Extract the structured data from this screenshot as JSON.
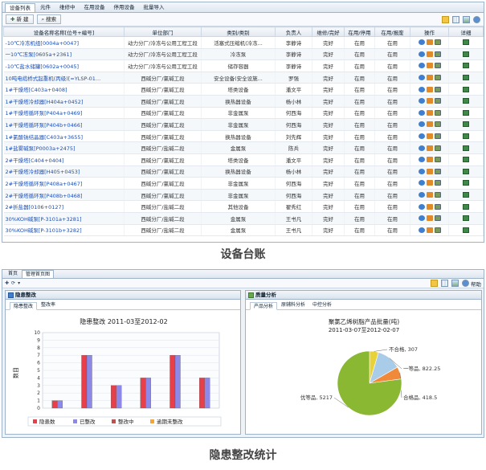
{
  "ledger": {
    "tabs": [
      "设备列表",
      "元件",
      "维修中",
      "在用设备",
      "停用设备",
      "批量导入"
    ],
    "active_tab": 0,
    "toolbar": {
      "new_label": "新 建",
      "search_label": "搜索"
    },
    "columns": [
      "设备名称名称[位号+编号]",
      "单位部门",
      "类别/类别",
      "负责人",
      "维修/完好",
      "在用/停用",
      "在用/报废",
      "操作",
      "详细"
    ],
    "rows": [
      [
        "-10℃冷冻机组[0004a+0047]",
        "动力分厂/冷冻与公用工程工段",
        "活塞式压缩机(冷冻...",
        "李静诗",
        "完好",
        "在用",
        "在用"
      ],
      [
        "一10℃冻泵[0605a+2361]",
        "动力分厂/冷冻与公用工程工段",
        "冷冻泵",
        "李静诗",
        "完好",
        "在用",
        "在用"
      ],
      [
        "-10℃盐水储罐[0602a+0045]",
        "动力分厂/冷冻与公用工程工段",
        "储存容器",
        "李静诗",
        "完好",
        "在用",
        "在用"
      ],
      [
        "10吨电缆桥式起重机(丙级)[=YLSP-01...",
        "西碱分厂/氯碱工段",
        "安全设备(安全设施...",
        "罗强",
        "完好",
        "在用",
        "在用"
      ],
      [
        "1#干燥塔[C403a+0408]",
        "西碱分厂/氯碱工段",
        "塔类设备",
        "潘文平",
        "完好",
        "在用",
        "在用"
      ],
      [
        "1#干燥塔冷却器[H404a+0452]",
        "西碱分厂/氯碱工段",
        "换热器设备",
        "杨小林",
        "完好",
        "在用",
        "在用"
      ],
      [
        "1#干燥塔循环泵[P404a+0469]",
        "西碱分厂/氯碱工段",
        "非金属泵",
        "何西海",
        "完好",
        "在用",
        "在用"
      ],
      [
        "1#干燥塔循环泵[P404b+0466]",
        "西碱分厂/氯碱工段",
        "非金属泵",
        "何西海",
        "完好",
        "在用",
        "在用"
      ],
      [
        "1#氯酸钠结晶器[C403a+3655]",
        "西碱分厂/氯碱工段",
        "换热器设备",
        "刘先辉",
        "完好",
        "在用",
        "在用"
      ],
      [
        "1#盐雾碱泵[P0003a+2475]",
        "西碱分厂/盐碱二段",
        "金属泵",
        "陈兵",
        "完好",
        "在用",
        "在用"
      ],
      [
        "2#干燥塔[C404+0404]",
        "西碱分厂/氯碱工段",
        "塔类设备",
        "潘文平",
        "完好",
        "在用",
        "在用"
      ],
      [
        "2#干燥塔冷却器[H405+0453]",
        "西碱分厂/氯碱工段",
        "换热器设备",
        "杨小林",
        "完好",
        "在用",
        "在用"
      ],
      [
        "2#干燥塔循环泵[P408a+0467]",
        "西碱分厂/氯碱工段",
        "非金属泵",
        "何西海",
        "完好",
        "在用",
        "在用"
      ],
      [
        "2#干燥塔循环泵[P408b+0468]",
        "西碱分厂/氯碱工段",
        "非金属泵",
        "何西海",
        "完好",
        "在用",
        "在用"
      ],
      [
        "2#折盐器[0106+0127]",
        "西碱分厂/盐碱二段",
        "其他设备",
        "翟秀红",
        "完好",
        "在用",
        "在用"
      ],
      [
        "30%KOH碱泵[P-3101a+3281]",
        "西碱分厂/盐碱二段",
        "金属泵",
        "王书凡",
        "完好",
        "在用",
        "在用"
      ],
      [
        "30%KOH碱泵[P-3101b+3282]",
        "西碱分厂/盐碱二段",
        "金属泵",
        "王书凡",
        "完好",
        "在用",
        "在用"
      ]
    ],
    "caption": "设备台账"
  },
  "stats": {
    "tabs": [
      "首页",
      "管理首页图"
    ],
    "active_tab": 1,
    "toolbar": {
      "help_label": "帮助"
    },
    "left_panel": {
      "title": "隐患整改",
      "tabs": [
        "隐患整改",
        "整改率"
      ],
      "active_tab": 0
    },
    "right_panel": {
      "title": "质量分析",
      "tabs": [
        "产品分析",
        "原辅料分析",
        "中控分析"
      ],
      "active_tab": 0
    },
    "caption": "隐患整改统计"
  },
  "chart_data": [
    {
      "type": "bar",
      "title": "隐患整改 2011-03至2012-02",
      "ylabel": "数目",
      "ylim": [
        0,
        10
      ],
      "yticks": [
        0,
        1,
        2,
        3,
        4,
        5,
        6,
        7,
        8,
        9,
        10
      ],
      "categories": [
        "",
        "",
        "",
        "",
        "",
        ""
      ],
      "series": [
        {
          "name": "隐患数",
          "values": [
            1,
            7,
            3,
            4,
            7,
            4
          ],
          "color": "#e8404a"
        },
        {
          "name": "已整改",
          "values": [
            1,
            7,
            3,
            4,
            7,
            4
          ],
          "color": "#8e88e8"
        },
        {
          "name": "整改中",
          "values": [
            0,
            0,
            0,
            0,
            0,
            0
          ],
          "color": "#c0504d"
        },
        {
          "name": "逾期未整改",
          "values": [
            0,
            0,
            0,
            0,
            0,
            0
          ],
          "color": "#f4a53a"
        }
      ],
      "legend": "bottom",
      "grid": true
    },
    {
      "type": "pie",
      "title": "聚氯乙烯树脂产品批量(吨)",
      "subtitle": "2011-03-07至2012-02-07",
      "slices": [
        {
          "label": "不合格",
          "value": 307,
          "color": "#e8d23a"
        },
        {
          "label": "一等品",
          "value": 822.25,
          "color": "#a9cde8"
        },
        {
          "label": "合格品",
          "value": 418.5,
          "color": "#f08a3a"
        },
        {
          "label": "优等品",
          "value": 5217,
          "color": "#8ab832"
        }
      ]
    }
  ]
}
